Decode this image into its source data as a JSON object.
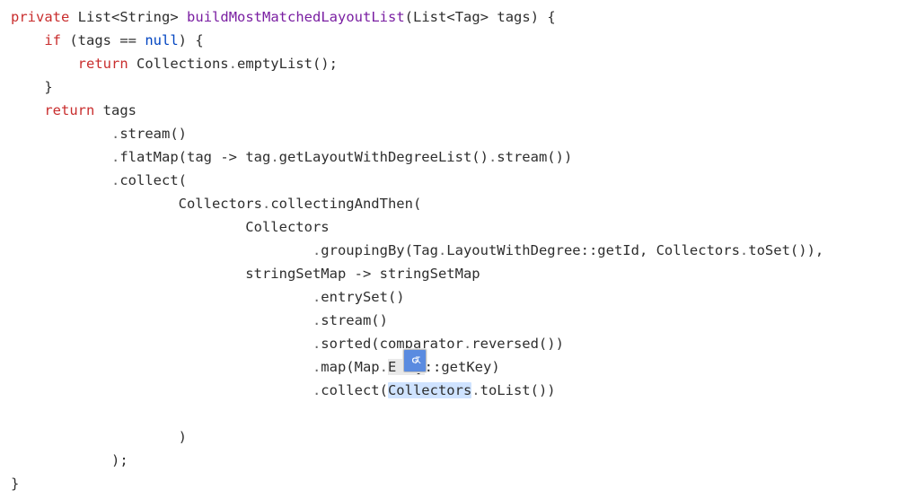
{
  "code": {
    "kw_private": "private",
    "type_list1": "List",
    "lt1": "<",
    "type_string": "String",
    "gt1": ">",
    "sp1": " ",
    "method_name": "buildMostMatchedLayoutList",
    "sig_open": "(",
    "type_list2": "List",
    "lt2": "<",
    "type_tag": "Tag",
    "gt2": ">",
    "param": " tags) {",
    "l2_indent": "    ",
    "kw_if": "if",
    "if_cond_a": " (tags ",
    "op_eq": "==",
    "sp2": " ",
    "kw_null": "null",
    "if_cond_b": ") {",
    "l3_indent": "        ",
    "kw_return1": "return",
    "l3_rest": " Collections",
    "l3_dot": ".",
    "l3_call": "emptyList();",
    "l4": "    }",
    "l5_indent": "    ",
    "kw_return2": "return",
    "l5_rest": " tags",
    "l6_indent": "            ",
    "l6_dot": ".",
    "l6_rest": "stream()",
    "l7_indent": "            ",
    "l7_dot": ".",
    "l7_a": "flatMap(tag ",
    "l7_arrow": "->",
    "l7_b": " tag",
    "l7_dot2": ".",
    "l7_c": "getLayoutWithDegreeList()",
    "l7_dot3": ".",
    "l7_d": "stream())",
    "l8_indent": "            ",
    "l8_dot": ".",
    "l8_rest": "collect(",
    "l9_indent": "                    ",
    "l9_a": "Collectors",
    "l9_dot": ".",
    "l9_b": "collectingAndThen(",
    "l10_indent": "                            ",
    "l10_a": "Collectors",
    "l11_indent": "                                    ",
    "l11_dot": ".",
    "l11_a": "groupingBy(Tag",
    "l11_dot2": ".",
    "l11_b": "LayoutWithDegree",
    "l11_cc": "::",
    "l11_c": "getId, Collectors",
    "l11_dot3": ".",
    "l11_d": "toSet()),",
    "l12_indent": "                            ",
    "l12_a": "stringSetMap ",
    "l12_arrow": "->",
    "l12_b": " stringSetMap",
    "l13_indent": "                                    ",
    "l13_dot": ".",
    "l13_a": "entrySet()",
    "l14_indent": "                                    ",
    "l14_dot": ".",
    "l14_a": "stream()",
    "l15_indent": "                                    ",
    "l15_dot": ".",
    "l15_a": "sorted(comparator",
    "l15_dot2": ".",
    "l15_b": "reversed())",
    "l16_indent": "                                    ",
    "l16_dot": ".",
    "l16_a": "map(Map",
    "l16_dot2": ".",
    "l16_b1": "E",
    "l16_b2": "y",
    "l16_cc": "::",
    "l16_c": "getKey)",
    "l17_indent": "                                    ",
    "l17_dot": ".",
    "l17_a": "collect(",
    "l17_sel": "Collectors",
    "l17_dot2": ".",
    "l17_b": "toList())",
    "l18": "",
    "l19_indent": "                    ",
    "l19_a": ")",
    "l20_indent": "            ",
    "l20_a": ");",
    "l21": "}"
  },
  "icon": {
    "name": "google-translate-icon"
  }
}
